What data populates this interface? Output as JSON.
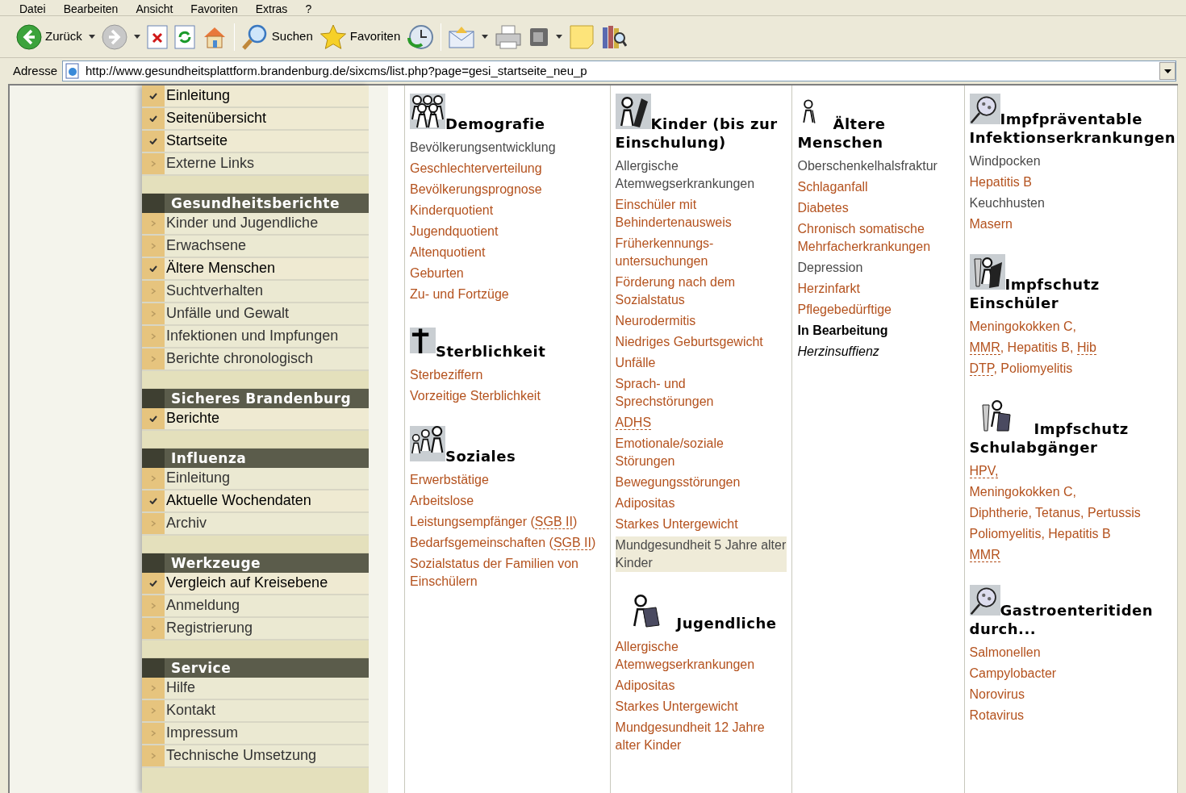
{
  "menu": [
    "Datei",
    "Bearbeiten",
    "Ansicht",
    "Favoriten",
    "Extras",
    "?"
  ],
  "toolbar": {
    "back": "Zurück",
    "search": "Suchen",
    "favorites": "Favoriten"
  },
  "address": {
    "label": "Adresse",
    "url": "http://www.gesundheitsplattform.brandenburg.de/sixcms/list.php?page=gesi_startseite_neu_p"
  },
  "nav": [
    {
      "items": [
        {
          "label": "Einleitung",
          "marked": true
        },
        {
          "label": "Seitenübersicht",
          "marked": true
        },
        {
          "label": "Startseite",
          "marked": true
        },
        {
          "label": "Externe Links",
          "marked": false
        }
      ]
    },
    {
      "title": "Gesundheitsberichte",
      "items": [
        {
          "label": "Kinder und Jugendliche",
          "marked": false
        },
        {
          "label": "Erwachsene",
          "marked": false
        },
        {
          "label": "Ältere Menschen",
          "marked": true
        },
        {
          "label": "Suchtverhalten",
          "marked": false
        },
        {
          "label": "Unfälle und Gewalt",
          "marked": false
        },
        {
          "label": "Infektionen und Impfungen",
          "marked": false
        },
        {
          "label": "Berichte chronologisch",
          "marked": false
        }
      ]
    },
    {
      "title": "Sicheres Brandenburg",
      "items": [
        {
          "label": "Berichte",
          "marked": true
        }
      ]
    },
    {
      "title": "Influenza",
      "items": [
        {
          "label": "Einleitung",
          "marked": false
        },
        {
          "label": "Aktuelle Wochendaten",
          "marked": true
        },
        {
          "label": "Archiv",
          "marked": false
        }
      ]
    },
    {
      "title": "Werkzeuge",
      "items": [
        {
          "label": "Vergleich auf Kreisebene",
          "marked": true
        },
        {
          "label": "Anmeldung",
          "marked": false
        },
        {
          "label": "Registrierung",
          "marked": false
        }
      ]
    },
    {
      "title": "Service",
      "items": [
        {
          "label": "Hilfe",
          "marked": false
        },
        {
          "label": "Kontakt",
          "marked": false
        },
        {
          "label": "Impressum",
          "marked": false
        },
        {
          "label": "Technische Umsetzung",
          "marked": false
        }
      ]
    }
  ],
  "columns": [
    {
      "sections": [
        {
          "title": "Demografie",
          "items": [
            {
              "kind": "link",
              "available": false,
              "highlighted": false,
              "text": "Bevölkerungsentwicklung"
            },
            {
              "kind": "link",
              "available": true,
              "highlighted": false,
              "text": "Geschlechterverteilung"
            },
            {
              "kind": "link",
              "available": true,
              "highlighted": false,
              "text": "Bevölkerungsprognose"
            },
            {
              "kind": "link",
              "available": true,
              "highlighted": false,
              "text": "Kinderquotient"
            },
            {
              "kind": "link",
              "available": true,
              "highlighted": false,
              "text": "Jugendquotient"
            },
            {
              "kind": "link",
              "available": true,
              "highlighted": false,
              "text": "Altenquotient"
            },
            {
              "kind": "link",
              "available": true,
              "highlighted": false,
              "text": "Geburten"
            },
            {
              "kind": "link",
              "available": true,
              "highlighted": false,
              "text": "Zu- und Fortzüge"
            }
          ]
        },
        {
          "title": "Sterblichkeit",
          "items": [
            {
              "kind": "link",
              "available": true,
              "highlighted": false,
              "text": "Sterbeziffern"
            },
            {
              "kind": "link",
              "available": true,
              "highlighted": false,
              "text": "Vorzeitige Sterblichkeit"
            }
          ]
        },
        {
          "title": "Soziales",
          "items": [
            {
              "kind": "link",
              "available": true,
              "highlighted": false,
              "text": "Erwerbstätige"
            },
            {
              "kind": "link",
              "available": true,
              "highlighted": false,
              "text": "Arbeitslose"
            },
            {
              "kind": "link",
              "available": true,
              "highlighted": false,
              "parts": [
                {
                  "text": "Leistungsempfänger (",
                  "abbr": false
                },
                {
                  "text": "SGB II",
                  "abbr": true
                },
                {
                  "text": ")",
                  "abbr": false
                }
              ]
            },
            {
              "kind": "link",
              "available": true,
              "highlighted": false,
              "parts": [
                {
                  "text": "Bedarfsgemeinschaften (",
                  "abbr": false
                },
                {
                  "text": "SGB II",
                  "abbr": true
                },
                {
                  "text": ")",
                  "abbr": false
                }
              ]
            },
            {
              "kind": "link",
              "available": true,
              "highlighted": false,
              "text": "Sozialstatus der Familien von Einschülern"
            }
          ]
        }
      ]
    },
    {
      "sections": [
        {
          "title": "Kinder (bis zur Einschulung)",
          "items": [
            {
              "kind": "link",
              "available": false,
              "highlighted": false,
              "text": "Allergische Atemwegserkrankungen"
            },
            {
              "kind": "link",
              "available": true,
              "highlighted": false,
              "text": "Einschüler mit Behindertenausweis"
            },
            {
              "kind": "link",
              "available": true,
              "highlighted": false,
              "text": "Früherkennungs-untersuchungen"
            },
            {
              "kind": "link",
              "available": true,
              "highlighted": false,
              "text": "Förderung nach dem Sozialstatus"
            },
            {
              "kind": "link",
              "available": true,
              "highlighted": false,
              "text": "Neurodermitis"
            },
            {
              "kind": "link",
              "available": true,
              "highlighted": false,
              "text": "Niedriges Geburtsgewicht"
            },
            {
              "kind": "link",
              "available": true,
              "highlighted": false,
              "text": "Unfälle"
            },
            {
              "kind": "link",
              "available": true,
              "highlighted": false,
              "text": "Sprach- und Sprechstörungen"
            },
            {
              "kind": "link",
              "available": true,
              "highlighted": false,
              "parts": [
                {
                  "text": "ADHS",
                  "abbr": true
                }
              ]
            },
            {
              "kind": "link",
              "available": true,
              "highlighted": false,
              "text": "Emotionale/soziale Störungen"
            },
            {
              "kind": "link",
              "available": true,
              "highlighted": false,
              "text": "Bewegungsstörungen"
            },
            {
              "kind": "link",
              "available": true,
              "highlighted": false,
              "text": "Adipositas"
            },
            {
              "kind": "link",
              "available": true,
              "highlighted": false,
              "text": "Starkes Untergewicht"
            },
            {
              "kind": "link",
              "available": false,
              "highlighted": true,
              "text": "Mundgesundheit 5 Jahre alter Kinder"
            }
          ]
        },
        {
          "title": "Jugendliche",
          "items": [
            {
              "kind": "link",
              "available": true,
              "highlighted": false,
              "text": "Allergische Atemwegserkrankungen"
            },
            {
              "kind": "link",
              "available": true,
              "highlighted": false,
              "text": "Adipositas"
            },
            {
              "kind": "link",
              "available": true,
              "highlighted": false,
              "text": "Starkes Untergewicht"
            },
            {
              "kind": "link",
              "available": true,
              "highlighted": false,
              "text": "Mundgesundheit 12 Jahre alter Kinder"
            }
          ]
        }
      ]
    },
    {
      "sections": [
        {
          "title": "Ältere Menschen",
          "items": [
            {
              "kind": "link",
              "available": false,
              "highlighted": false,
              "text": "Oberschenkelhalsfraktur"
            },
            {
              "kind": "link",
              "available": true,
              "highlighted": false,
              "text": "Schlaganfall"
            },
            {
              "kind": "link",
              "available": true,
              "highlighted": false,
              "text": "Diabetes"
            },
            {
              "kind": "link",
              "available": true,
              "highlighted": false,
              "text": "Chronisch somatische Mehrfacherkrankungen"
            },
            {
              "kind": "link",
              "available": false,
              "highlighted": false,
              "text": "Depression"
            },
            {
              "kind": "link",
              "available": true,
              "highlighted": false,
              "text": "Herzinfarkt"
            },
            {
              "kind": "link",
              "available": true,
              "highlighted": false,
              "text": "Pflegebedürftige"
            },
            {
              "kind": "subheading",
              "text": "In Bearbeitung"
            },
            {
              "kind": "note",
              "text": "Herzinsuffienz"
            }
          ]
        }
      ]
    },
    {
      "sections": [
        {
          "title": "Impfpräventable Infektionserkrankungen",
          "items": [
            {
              "kind": "link",
              "available": false,
              "highlighted": false,
              "text": "Windpocken"
            },
            {
              "kind": "link",
              "available": true,
              "highlighted": false,
              "text": "Hepatitis B"
            },
            {
              "kind": "link",
              "available": false,
              "highlighted": false,
              "text": "Keuchhusten"
            },
            {
              "kind": "link",
              "available": true,
              "highlighted": false,
              "text": "Masern"
            }
          ]
        },
        {
          "title": "Impfschutz Einschüler",
          "items": [
            {
              "kind": "link",
              "available": true,
              "highlighted": false,
              "text": "Meningokokken C,"
            },
            {
              "kind": "link",
              "available": true,
              "highlighted": false,
              "parts": [
                {
                  "text": "MMR",
                  "abbr": true
                },
                {
                  "text": ", Hepatitis B, ",
                  "abbr": false
                },
                {
                  "text": "Hib",
                  "abbr": true
                }
              ]
            },
            {
              "kind": "link",
              "available": true,
              "highlighted": false,
              "parts": [
                {
                  "text": "DTP",
                  "abbr": true
                },
                {
                  "text": ", Poliomyelitis",
                  "abbr": false
                }
              ]
            }
          ]
        },
        {
          "title": "Impfschutz Schulabgänger",
          "items": [
            {
              "kind": "link",
              "available": true,
              "highlighted": false,
              "parts": [
                {
                  "text": "HPV,",
                  "abbr": true
                }
              ]
            },
            {
              "kind": "link",
              "available": true,
              "highlighted": false,
              "text": "Meningokokken C,"
            },
            {
              "kind": "link",
              "available": true,
              "highlighted": false,
              "text": "Diphtherie, Tetanus, Pertussis"
            },
            {
              "kind": "link",
              "available": true,
              "highlighted": false,
              "text": "Poliomyelitis, Hepatitis B"
            },
            {
              "kind": "link",
              "available": true,
              "highlighted": false,
              "parts": [
                {
                  "text": "MMR",
                  "abbr": true
                }
              ]
            }
          ]
        },
        {
          "title": "Gastroenteritiden durch...",
          "items": [
            {
              "kind": "link",
              "available": true,
              "highlighted": false,
              "text": "Salmonellen"
            },
            {
              "kind": "link",
              "available": true,
              "highlighted": false,
              "text": "Campylobacter"
            },
            {
              "kind": "link",
              "available": true,
              "highlighted": false,
              "text": "Norovirus"
            },
            {
              "kind": "link",
              "available": true,
              "highlighted": false,
              "text": "Rotavirus"
            }
          ]
        }
      ]
    }
  ]
}
